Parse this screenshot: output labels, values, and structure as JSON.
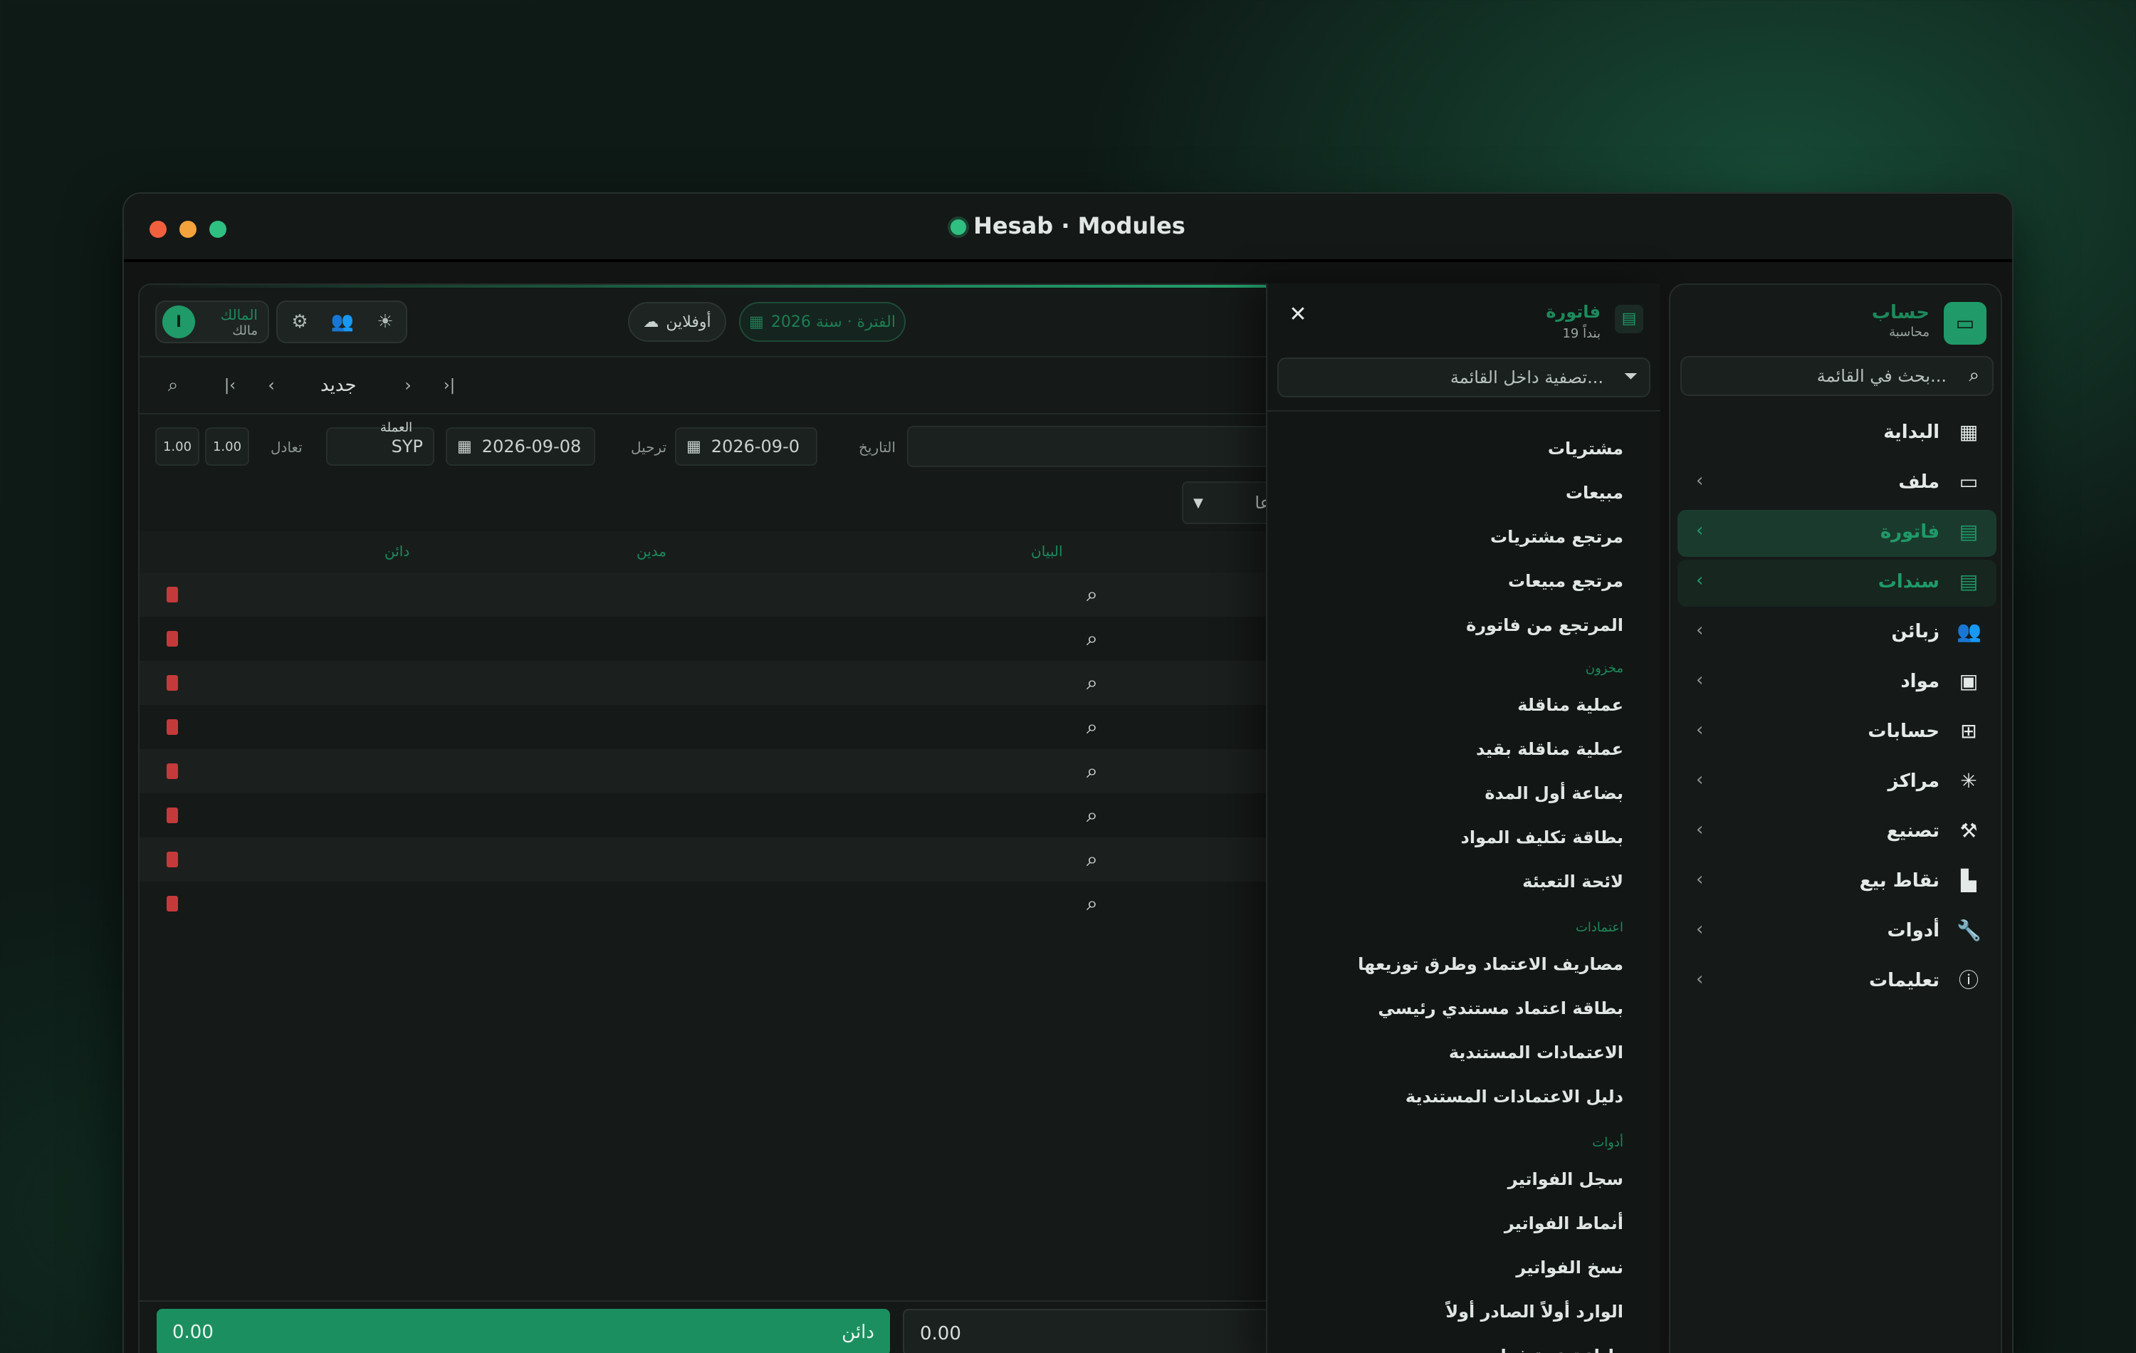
{
  "window": {
    "title": "Hesab · Modules"
  },
  "main": {
    "toolbar": {
      "user_name": "المالك",
      "user_role": "مالك",
      "avatar_letter": "ا",
      "offline_label": "أوفلاين",
      "period_label": "الفترة · سنة 2026"
    },
    "nav": {
      "new_label": "جديد"
    },
    "form": {
      "date_label": "التاريخ",
      "date_value": "2026-09-0",
      "posting_label": "ترحيل",
      "posting_value": "2026-09-08",
      "currency_label": "العملة",
      "currency_value": "SYP",
      "equivalent_label": "تعادل",
      "rate1": "1.00",
      "rate2": "1.00",
      "dropdown_stub": "عا"
    },
    "table": {
      "col_statement": "البيان",
      "col_debit": "مدين",
      "col_credit": "دائن",
      "rows": 8
    },
    "footer": {
      "credit_label": "دائن",
      "credit_value": "0.00",
      "debit_value": "0.00"
    }
  },
  "dropdown": {
    "title": "فاتورة",
    "count": "19 بنداً",
    "filter_placeholder": "تصفية داخل القائمة...",
    "items_top": [
      "مشتريات",
      "مبيعات",
      "مرتجع مشتريات",
      "مرتجع مبيعات",
      "المرتجع من فاتورة"
    ],
    "section_store": "مخزون",
    "items_store": [
      "عملية مناقلة",
      "عملية مناقلة بقيد",
      "بضاعة أول المدة",
      "بطاقة تكليف المواد",
      "لائحة التعبئة"
    ],
    "section_credits": "اعتمادات",
    "items_credits": [
      "مصاريف الاعتماد وطرق توزيعها",
      "بطاقة اعتماد مستندي رئيسي",
      "الاعتمادات المستندية",
      "دليل الاعتمادات المستندية"
    ],
    "section_tools": "أدوات",
    "items_tools": [
      "سجل الفواتير",
      "أنماط الفواتير",
      "نسخ الفواتير",
      "الوارد أولاً الصادر أولاً",
      "طباعة عدة فواتير"
    ]
  },
  "sidebar": {
    "brand_title": "حساب",
    "brand_subtitle": "محاسبة",
    "search_placeholder": "بحث في القائمة...",
    "items": [
      {
        "label": "البداية",
        "icon": "calendar-icon"
      },
      {
        "label": "ملف",
        "icon": "folder-icon"
      },
      {
        "label": "فاتورة",
        "icon": "invoice-icon"
      },
      {
        "label": "سندات",
        "icon": "voucher-icon"
      },
      {
        "label": "زبائن",
        "icon": "users-icon"
      },
      {
        "label": "مواد",
        "icon": "box-icon"
      },
      {
        "label": "حسابات",
        "icon": "tree-icon"
      },
      {
        "label": "مراكز",
        "icon": "network-icon"
      },
      {
        "label": "تصنيع",
        "icon": "factory-icon"
      },
      {
        "label": "نقاط بيع",
        "icon": "pos-icon"
      },
      {
        "label": "أدوات",
        "icon": "wrench-icon"
      },
      {
        "label": "تعليمات",
        "icon": "help-icon"
      }
    ]
  },
  "colors": {
    "accent": "#1f9a68",
    "accent_dim": "#1c8a5c",
    "danger": "#c43a3a"
  }
}
